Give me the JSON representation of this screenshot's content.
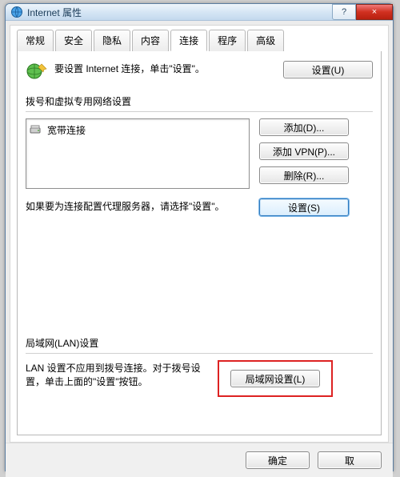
{
  "window": {
    "title": "Internet 属性",
    "help_label": "?",
    "close_label": "×"
  },
  "tabs": {
    "items": [
      {
        "label": "常规"
      },
      {
        "label": "安全"
      },
      {
        "label": "隐私"
      },
      {
        "label": "内容"
      },
      {
        "label": "连接"
      },
      {
        "label": "程序"
      },
      {
        "label": "高级"
      }
    ],
    "active_index": 4
  },
  "setup": {
    "description": "要设置 Internet 连接，单击\"设置\"。",
    "button": "设置(U)"
  },
  "dialup": {
    "group_label": "拨号和虚拟专用网络设置",
    "items": [
      {
        "icon": "modem-icon",
        "label": "宽带连接"
      }
    ],
    "add_button": "添加(D)...",
    "add_vpn_button": "添加 VPN(P)...",
    "remove_button": "删除(R)..."
  },
  "proxy": {
    "description": "如果要为连接配置代理服务器，请选择\"设置\"。",
    "button": "设置(S)"
  },
  "lan": {
    "group_label": "局域网(LAN)设置",
    "description": "LAN 设置不应用到拨号连接。对于拨号设置，单击上面的\"设置\"按钮。",
    "button": "局域网设置(L)"
  },
  "footer": {
    "ok": "确定",
    "cancel": "取"
  }
}
